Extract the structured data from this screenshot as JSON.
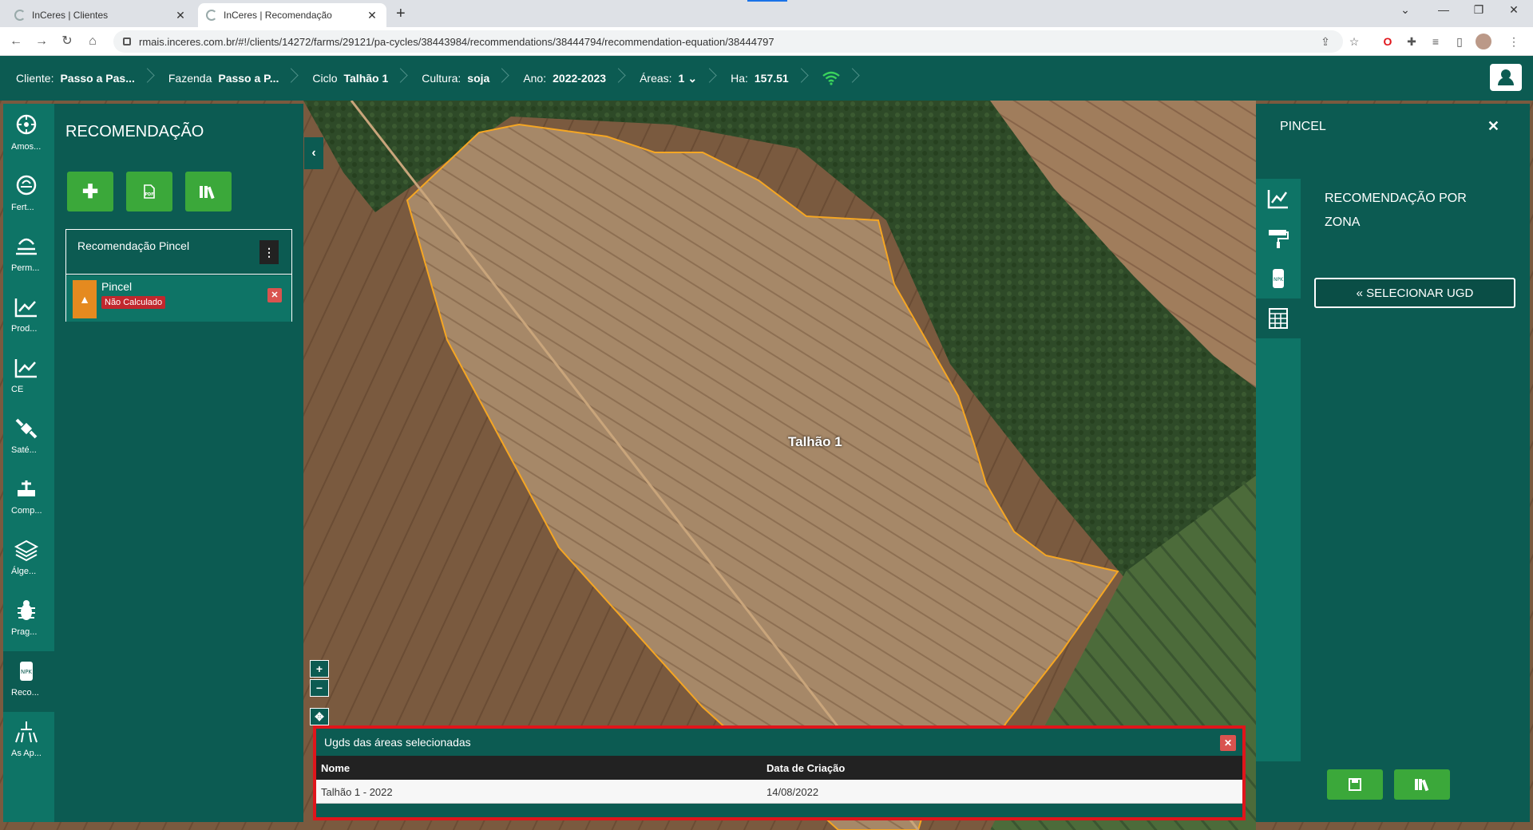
{
  "browser": {
    "tabs": [
      {
        "label": "InCeres | Clientes",
        "active": false
      },
      {
        "label": "InCeres | Recomendação",
        "active": true
      }
    ],
    "url": "rmais.inceres.com.br/#!/clients/14272/farms/29121/pa-cycles/38443984/recommendations/38444794/recommendation-equation/38444797"
  },
  "header": {
    "cliente_label": "Cliente:",
    "cliente_value": "Passo a Pas...",
    "fazenda_label": "Fazenda",
    "fazenda_value": "Passo a P...",
    "ciclo_label": "Ciclo",
    "ciclo_value": "Talhão 1",
    "cultura_label": "Cultura:",
    "cultura_value": "soja",
    "ano_label": "Ano:",
    "ano_value": "2022-2023",
    "areas_label": "Áreas:",
    "areas_value": "1",
    "ha_label": "Ha:",
    "ha_value": "157.51"
  },
  "iconbar": [
    {
      "label": "Amos...",
      "icon": "sampling-icon"
    },
    {
      "label": "Fert...",
      "icon": "fertility-icon"
    },
    {
      "label": "Perm...",
      "icon": "permanent-icon"
    },
    {
      "label": "Prod...",
      "icon": "productivity-icon"
    },
    {
      "label": "CE",
      "icon": "ce-icon"
    },
    {
      "label": "Saté...",
      "icon": "satellite-icon"
    },
    {
      "label": "Comp...",
      "icon": "compaction-icon"
    },
    {
      "label": "Álge...",
      "icon": "layers-icon"
    },
    {
      "label": "Prag...",
      "icon": "bug-icon"
    },
    {
      "label": "Reco...",
      "icon": "recommendation-icon"
    },
    {
      "label": "As Ap...",
      "icon": "application-icon"
    }
  ],
  "leftpanel": {
    "title": "RECOMENDAÇÃO",
    "card_title": "Recomendação Pincel",
    "item_name": "Pincel",
    "item_status": "Não Calculado"
  },
  "map": {
    "field_label": "Talhão 1"
  },
  "ugd_panel": {
    "title": "Ugds das áreas selecionadas",
    "col_nome": "Nome",
    "col_data": "Data de Criação",
    "rows": [
      {
        "nome": "Talhão 1 - 2022",
        "data": "14/08/2022"
      }
    ]
  },
  "rightpanel": {
    "title": "PINCEL",
    "heading": "RECOMENDAÇÃO POR ZONA",
    "select_label": "« SELECIONAR UGD"
  },
  "colors": {
    "primary": "#0c5b52",
    "secondary": "#0e7466",
    "button_green": "#3ba83a",
    "warning": "#e58a1f",
    "danger": "#c1272d",
    "field_outline": "#f5a623"
  }
}
